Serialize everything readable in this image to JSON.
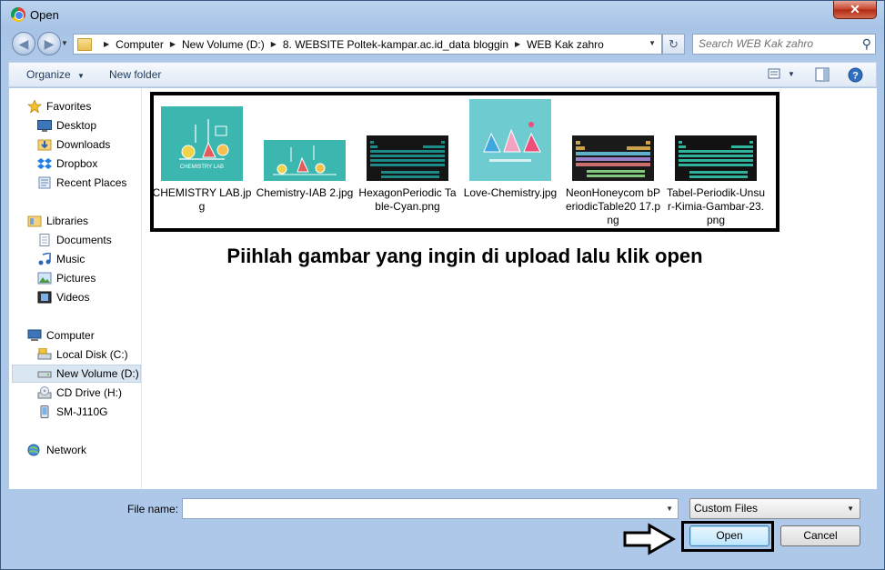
{
  "window": {
    "title": "Open",
    "close_glyph": "✕"
  },
  "nav": {
    "back_glyph": "◀",
    "forward_glyph": "▶",
    "breadcrumbs": [
      "Computer",
      "New Volume (D:)",
      "8. WEBSITE Poltek-kampar.ac.id_data bloggin",
      "WEB Kak zahro"
    ],
    "refresh_glyph": "↻",
    "search_placeholder": "Search WEB Kak zahro"
  },
  "toolbar": {
    "organize": "Organize",
    "new_folder": "New folder"
  },
  "sidebar": {
    "favorites_header": "Favorites",
    "favorites": [
      "Desktop",
      "Downloads",
      "Dropbox",
      "Recent Places"
    ],
    "libraries_header": "Libraries",
    "libraries": [
      "Documents",
      "Music",
      "Pictures",
      "Videos"
    ],
    "computer_header": "Computer",
    "drives": [
      "Local Disk (C:)",
      "New Volume (D:)",
      "CD Drive (H:)",
      "SM-J110G"
    ],
    "network_header": "Network"
  },
  "files": [
    {
      "name": "CHEMISTRY LAB.jpg",
      "thumb_text": "CHEMISTRY LAB"
    },
    {
      "name": "Chemistry-IAB 2.jpg"
    },
    {
      "name": "HexagonPeriodic Table-Cyan.png"
    },
    {
      "name": "Love-Chemistry.jpg"
    },
    {
      "name": "NeonHoneycom bPeriodicTable20 17.png"
    },
    {
      "name": "Tabel-Periodik-Unsur-Kimia-Gambar-23.png"
    }
  ],
  "instruction": "Piihlah gambar yang ingin di upload lalu klik open",
  "bottom": {
    "file_name_label": "File name:",
    "file_name_value": "",
    "file_type": "Custom Files",
    "open_label": "Open",
    "cancel_label": "Cancel"
  },
  "colors": {
    "teal": "#3bb7b0",
    "dark": "#141414",
    "title_bg": "#bcd3ee"
  }
}
